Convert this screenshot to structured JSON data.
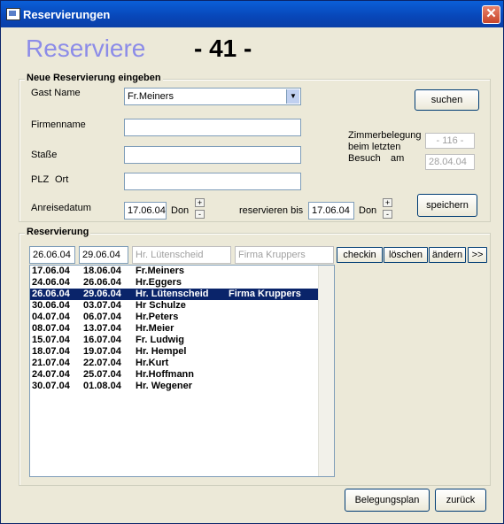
{
  "window": {
    "title": "Reservierungen",
    "close": "✕"
  },
  "heading": {
    "title": "Reserviere",
    "number": "- 41 -"
  },
  "new_res": {
    "legend": "Neue Reservierung eingeben",
    "gast_label": "Gast Name",
    "gast_value": "Fr.Meiners",
    "firma_label": "Firmenname",
    "strasse_label": "Staße",
    "plz_label": "PLZ",
    "ort_label": "Ort",
    "anreise_label": "Anreisedatum",
    "anreise_value": "17.06.04",
    "anreise_day": "Don",
    "bis_label": "reservieren bis",
    "bis_value": "17.06.04",
    "bis_day": "Don",
    "zimmer_label1": "Zimmerbelegung",
    "zimmer_label2": "beim letzten",
    "zimmer_label3": "Besuch",
    "zimmer_label4": "am",
    "zimmer_value": "- 116 -",
    "zimmer_date": "28.04.04",
    "suchen": "suchen",
    "speichern": "speichern",
    "plus": "+",
    "minus": "-"
  },
  "reservierung": {
    "legend": "Reservierung",
    "from": "26.06.04",
    "to": "29.06.04",
    "name": "Hr. Lütenscheid",
    "firma": "Firma Kruppers",
    "checkin": "checkin",
    "loeschen": "löschen",
    "aendern": "ändern",
    "more": ">>",
    "rows": [
      {
        "from": "17.06.04",
        "to": "18.06.04",
        "name": "Fr.Meiners",
        "firma": ""
      },
      {
        "from": "24.06.04",
        "to": "26.06.04",
        "name": "Hr.Eggers",
        "firma": ""
      },
      {
        "from": "26.06.04",
        "to": "29.06.04",
        "name": "Hr. Lütenscheid",
        "firma": "Firma Kruppers"
      },
      {
        "from": "30.06.04",
        "to": "03.07.04",
        "name": "Hr Schulze",
        "firma": ""
      },
      {
        "from": "04.07.04",
        "to": "06.07.04",
        "name": "Hr.Peters",
        "firma": ""
      },
      {
        "from": "08.07.04",
        "to": "13.07.04",
        "name": "Hr.Meier",
        "firma": ""
      },
      {
        "from": "15.07.04",
        "to": "16.07.04",
        "name": "Fr. Ludwig",
        "firma": ""
      },
      {
        "from": "18.07.04",
        "to": "19.07.04",
        "name": "Hr. Hempel",
        "firma": ""
      },
      {
        "from": "21.07.04",
        "to": "22.07.04",
        "name": "Hr.Kurt",
        "firma": ""
      },
      {
        "from": "24.07.04",
        "to": "25.07.04",
        "name": "Hr.Hoffmann",
        "firma": ""
      },
      {
        "from": "30.07.04",
        "to": "01.08.04",
        "name": "Hr. Wegener",
        "firma": ""
      }
    ],
    "selected_index": 2
  },
  "footer": {
    "belegungsplan": "Belegungsplan",
    "zurueck": "zurück"
  }
}
